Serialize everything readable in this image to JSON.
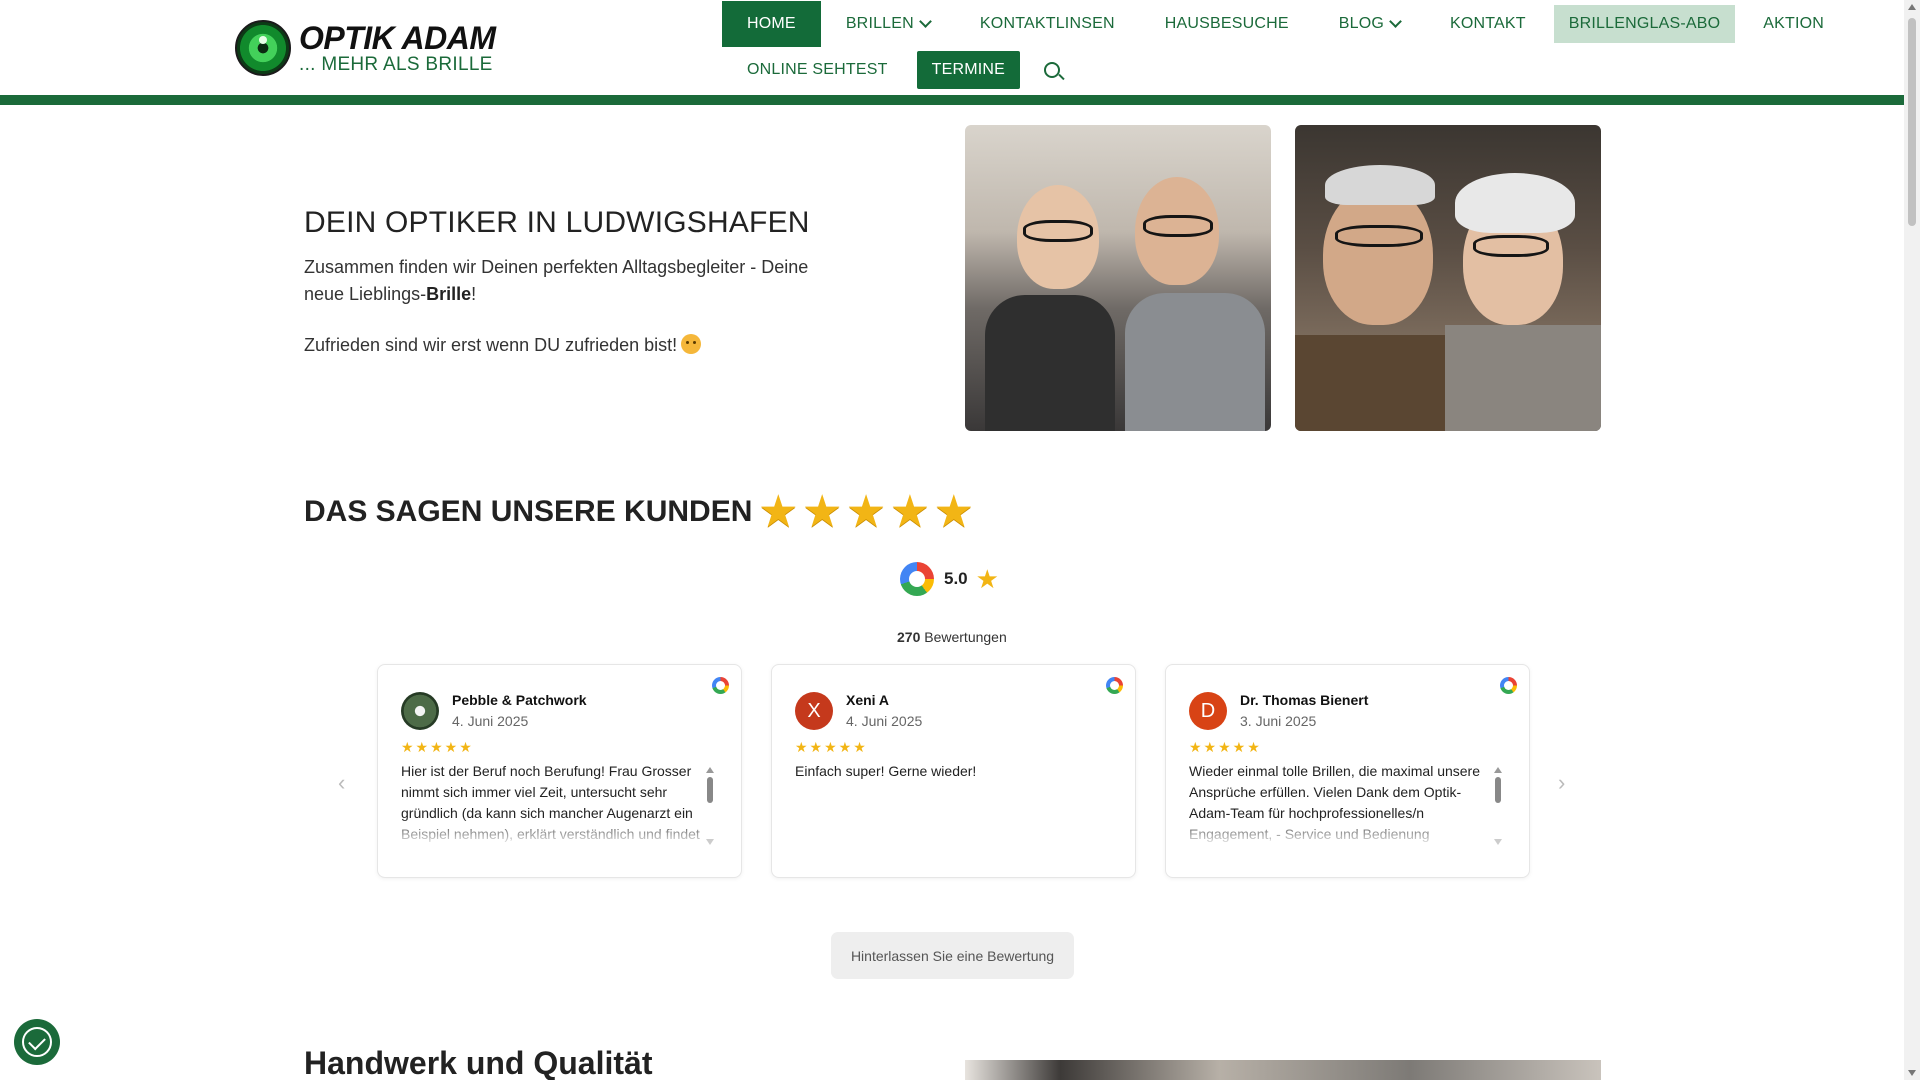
{
  "brand": {
    "name": "OPTIK ADAM",
    "tagline": "... MEHR ALS BRILLE",
    "accent_color": "#1b6a3a"
  },
  "nav": {
    "row1": [
      {
        "label": "HOME",
        "active": true
      },
      {
        "label": "BRILLEN",
        "has_dropdown": true
      },
      {
        "label": "KONTAKTLINSEN"
      },
      {
        "label": "HAUSBESUCHE"
      },
      {
        "label": "BLOG",
        "has_dropdown": true
      },
      {
        "label": "KONTAKT"
      },
      {
        "label": "BRILLENGLAS-ABO",
        "highlight": true
      },
      {
        "label": "AKTION"
      }
    ],
    "row2": [
      {
        "label": "ONLINE SEHTEST"
      },
      {
        "label": "TERMINE",
        "highlight": true
      }
    ],
    "search_icon": "search-icon"
  },
  "hero": {
    "title": "DEIN OPTIKER IN LUDWIGSHAFEN",
    "text_pre": "Zusammen finden wir Deinen perfekten Alltagsbegleiter - Deine neue Lieblings-",
    "text_bold": "Brille",
    "text_post": "!",
    "text2": "Zufrieden sind wir erst wenn DU zufrieden bist!"
  },
  "reviews": {
    "title": "DAS SAGEN UNSERE KUNDEN",
    "stars": 5,
    "rating": "5.0",
    "count": "270",
    "count_label": "Bewertungen",
    "items": [
      {
        "name": "Pebble & Patchwork",
        "date": "4. Juni 2025",
        "rating": 5,
        "avatar_letter": "",
        "avatar_color": "#3d5a3a",
        "text": "Hier ist der Beruf noch Berufung! Frau Grosser nimmt sich immer viel Zeit, untersucht sehr gründlich (da kann sich mancher Augenarzt ein Beispiel nehmen), erklärt verständlich und findet für alles eine Lösung. Es gibt immer das"
      },
      {
        "name": "Xeni A",
        "date": "4. Juni 2025",
        "rating": 5,
        "avatar_letter": "X",
        "avatar_color": "#c5391c",
        "text": "Einfach super! Gerne wieder!"
      },
      {
        "name": "Dr. Thomas Bienert",
        "date": "3. Juni 2025",
        "rating": 5,
        "avatar_letter": "D",
        "avatar_color": "#d84315",
        "text": "Wieder einmal tolle Brillen, die maximal unsere Ansprüche erfüllen. Vielen Dank dem Optik-Adam-Team für hochprofessionelles/n Engagement, - Service und Bedienung"
      }
    ],
    "leave_review": "Hinterlassen Sie eine Bewertung",
    "prev_arrow": "‹",
    "next_arrow": "›",
    "star_glyph": "★"
  },
  "section2": {
    "title": "Handwerk und Qualität"
  }
}
